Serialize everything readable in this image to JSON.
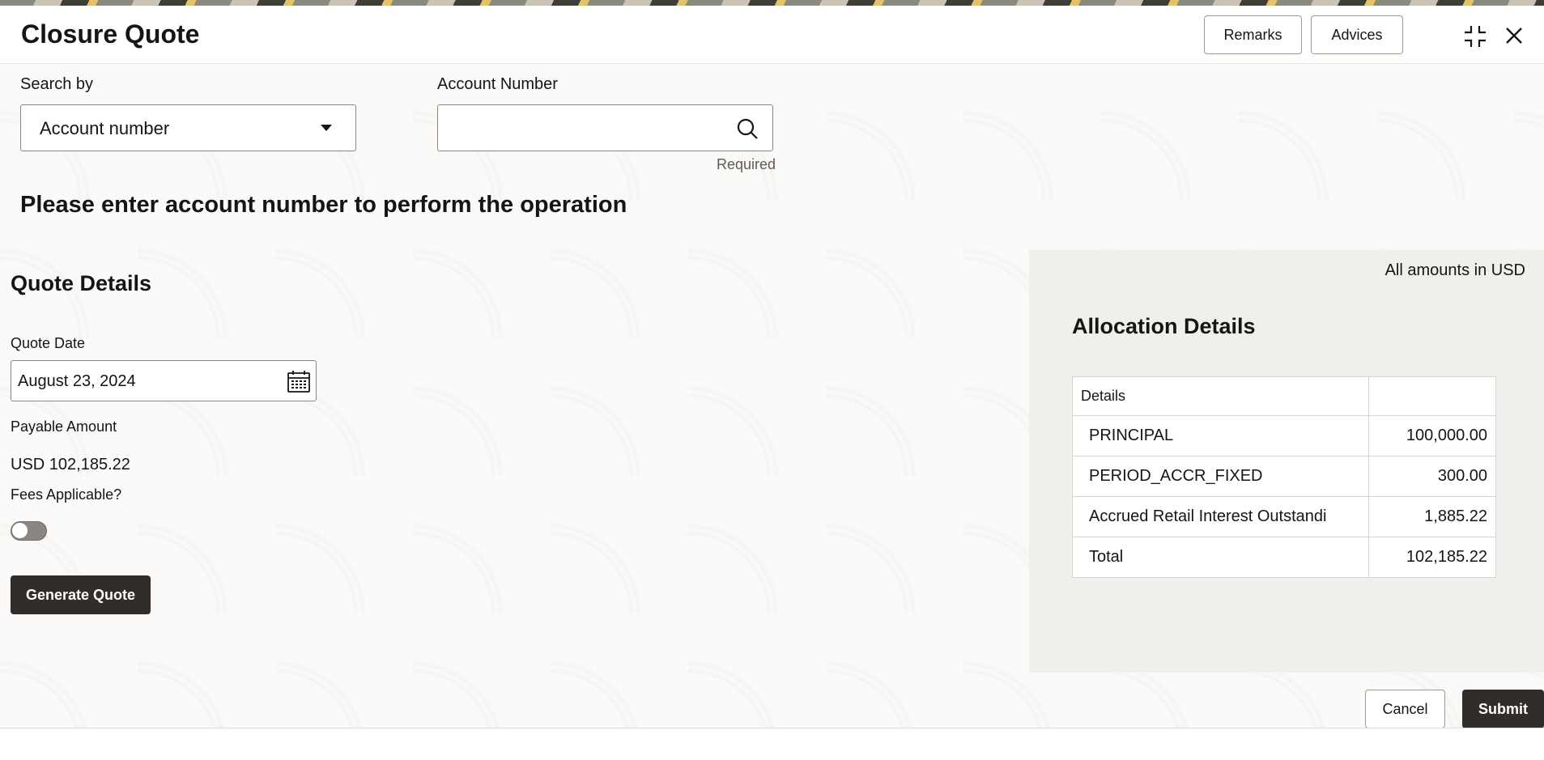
{
  "header": {
    "title": "Closure Quote",
    "remarks_label": "Remarks",
    "advices_label": "Advices"
  },
  "search": {
    "search_by_label": "Search by",
    "search_by_value": "Account number",
    "account_number_label": "Account Number",
    "account_number_value": "",
    "required_text": "Required"
  },
  "message": "Please enter account number to perform the operation",
  "quote": {
    "section_title": "Quote Details",
    "quote_date_label": "Quote Date",
    "quote_date_value": "August 23, 2024",
    "payable_label": "Payable Amount",
    "payable_value": "USD 102,185.22",
    "fees_label": "Fees Applicable?",
    "fees_applicable": false,
    "generate_label": "Generate Quote"
  },
  "allocation": {
    "currency_note": "All amounts in USD",
    "title": "Allocation Details",
    "header_details": "Details",
    "header_amount": "",
    "rows": [
      {
        "name": "PRINCIPAL",
        "amount": "100,000.00"
      },
      {
        "name": "PERIOD_ACCR_FIXED",
        "amount": "300.00"
      },
      {
        "name": "Accrued Retail Interest Outstandi",
        "amount": "1,885.22"
      },
      {
        "name": "Total",
        "amount": "102,185.22"
      }
    ]
  },
  "footer": {
    "cancel_label": "Cancel",
    "submit_label": "Submit"
  }
}
